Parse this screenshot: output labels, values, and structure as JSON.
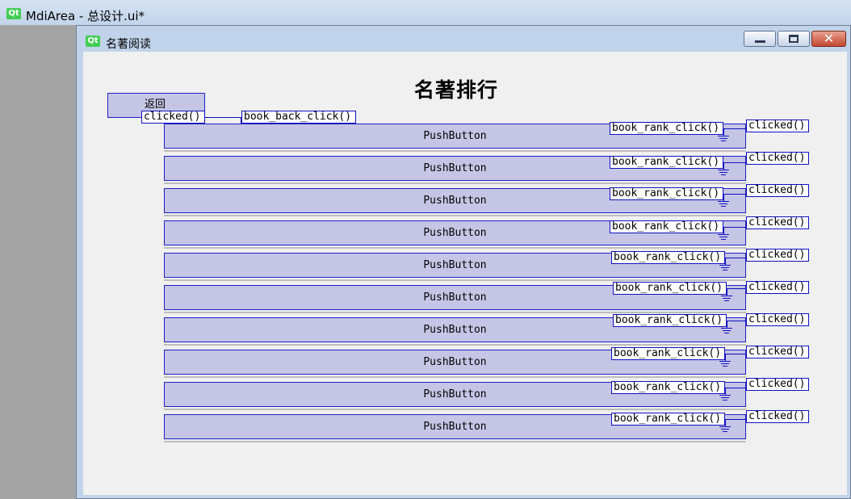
{
  "app": {
    "title": "MdiArea - 总设计.ui*",
    "logo": "Qt"
  },
  "subwindow": {
    "title": "名著阅读",
    "logo": "Qt"
  },
  "page": {
    "heading": "名著排行"
  },
  "back": {
    "label": "返回",
    "signal": "clicked()",
    "slot": "book_back_click()"
  },
  "rank_buttons": [
    {
      "label": "PushButton",
      "slot": "book_rank_click()",
      "signal": "clicked()"
    },
    {
      "label": "PushButton",
      "slot": "book_rank_click()",
      "signal": "clicked()"
    },
    {
      "label": "PushButton",
      "slot": "book_rank_click()",
      "signal": "clicked()"
    },
    {
      "label": "PushButton",
      "slot": "book_rank_click()",
      "signal": "clicked()"
    },
    {
      "label": "PushButton",
      "slot": "book_rank_click()",
      "signal": "clicked()"
    },
    {
      "label": "PushButton",
      "slot": "book_rank_click()",
      "signal": "clicked()"
    },
    {
      "label": "PushButton",
      "slot": "book_rank_click()",
      "signal": "clicked()"
    },
    {
      "label": "PushButton",
      "slot": "book_rank_click()",
      "signal": "clicked()"
    },
    {
      "label": "PushButton",
      "slot": "book_rank_click()",
      "signal": "clicked()"
    },
    {
      "label": "PushButton",
      "slot": "book_rank_click()",
      "signal": "clicked()"
    }
  ],
  "colors": {
    "accent": "#1010c0",
    "button_fill": "#c5c5e6",
    "client_bg": "#f0f0f0"
  }
}
